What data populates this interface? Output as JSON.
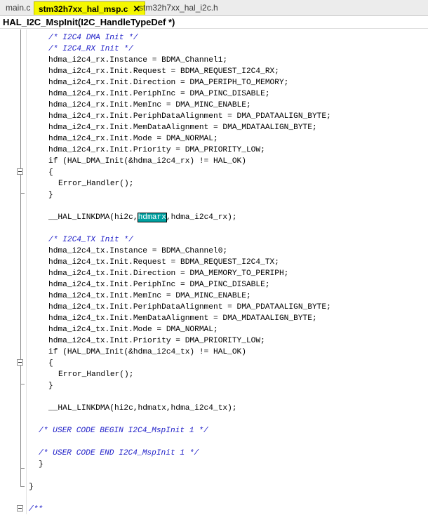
{
  "tabs": [
    {
      "label": "main.c",
      "active": false
    },
    {
      "label": "stm32h7xx_hal_msp.c",
      "active": true
    },
    {
      "label": "stm32h7xx_hal_i2c.h",
      "active": false
    }
  ],
  "close_glyph": "✕",
  "function_bar": "HAL_I2C_MspInit(I2C_HandleTypeDef *)",
  "code": {
    "l1": "/* I2C4 DMA Init */",
    "l2": "/* I2C4_RX Init */",
    "l3": "hdma_i2c4_rx.Instance = BDMA_Channel1;",
    "l4": "hdma_i2c4_rx.Init.Request = BDMA_REQUEST_I2C4_RX;",
    "l5": "hdma_i2c4_rx.Init.Direction = DMA_PERIPH_TO_MEMORY;",
    "l6": "hdma_i2c4_rx.Init.PeriphInc = DMA_PINC_DISABLE;",
    "l7": "hdma_i2c4_rx.Init.MemInc = DMA_MINC_ENABLE;",
    "l8": "hdma_i2c4_rx.Init.PeriphDataAlignment = DMA_PDATAALIGN_BYTE;",
    "l9": "hdma_i2c4_rx.Init.MemDataAlignment = DMA_MDATAALIGN_BYTE;",
    "l10": "hdma_i2c4_rx.Init.Mode = DMA_NORMAL;",
    "l11": "hdma_i2c4_rx.Init.Priority = DMA_PRIORITY_LOW;",
    "l12": "if (HAL_DMA_Init(&hdma_i2c4_rx) != HAL_OK)",
    "l13": "{",
    "l14": "Error_Handler();",
    "l15": "}",
    "l17a": "__HAL_LINKDMA(hi2c,",
    "l17b": "hdmarx",
    "l17c": ",hdma_i2c4_rx);",
    "l19": "/* I2C4_TX Init */",
    "l20": "hdma_i2c4_tx.Instance = BDMA_Channel0;",
    "l21": "hdma_i2c4_tx.Init.Request = BDMA_REQUEST_I2C4_TX;",
    "l22": "hdma_i2c4_tx.Init.Direction = DMA_MEMORY_TO_PERIPH;",
    "l23": "hdma_i2c4_tx.Init.PeriphInc = DMA_PINC_DISABLE;",
    "l24": "hdma_i2c4_tx.Init.MemInc = DMA_MINC_ENABLE;",
    "l25": "hdma_i2c4_tx.Init.PeriphDataAlignment = DMA_PDATAALIGN_BYTE;",
    "l26": "hdma_i2c4_tx.Init.MemDataAlignment = DMA_MDATAALIGN_BYTE;",
    "l27": "hdma_i2c4_tx.Init.Mode = DMA_NORMAL;",
    "l28": "hdma_i2c4_tx.Init.Priority = DMA_PRIORITY_LOW;",
    "l29": "if (HAL_DMA_Init(&hdma_i2c4_tx) != HAL_OK)",
    "l30": "{",
    "l31": "Error_Handler();",
    "l32": "}",
    "l34": "__HAL_LINKDMA(hi2c,hdmatx,hdma_i2c4_tx);",
    "l36": "/* USER CODE BEGIN I2C4_MspInit 1 */",
    "l38": "/* USER CODE END I2C4_MspInit 1 */",
    "l39": "}",
    "l41": "}",
    "l43": "/**"
  },
  "colors": {
    "active_tab": "#f5f700",
    "comment": "#2020c8",
    "selection": "#00a0a0"
  }
}
